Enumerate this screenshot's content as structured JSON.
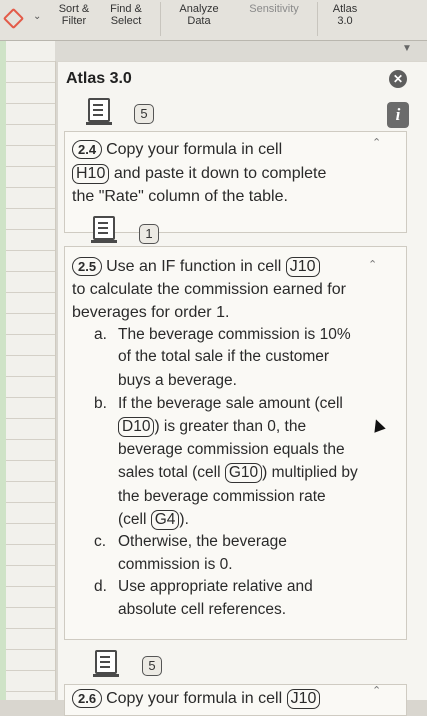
{
  "ribbon": {
    "sort": [
      "Sort &",
      "Filter"
    ],
    "find": [
      "Find &",
      "Select"
    ],
    "analyze": [
      "Analyze",
      "Data"
    ],
    "sensitivity": "Sensitivity",
    "atlas": [
      "Atlas",
      "3.0"
    ]
  },
  "pane": {
    "title": "Atlas 3.0",
    "close_icon": "close-icon",
    "info_label": "i"
  },
  "items": [
    {
      "badge": "5"
    },
    {
      "step": "2.4",
      "line1_pre": "Copy your formula in cell",
      "line2_ref": "H10",
      "line2_post": "and paste it down to complete",
      "line3": "the \"Rate\" column of the table.",
      "badge": "1"
    },
    {
      "step": "2.5",
      "line1_pre": "Use an IF function in cell",
      "line1_ref": "J10",
      "line2": "to calculate the commission earned for",
      "line3": "beverages for order 1.",
      "a_marker": "a.",
      "a1": "The beverage commission is 10%",
      "a2": "of the total sale if the customer",
      "a3": "buys a beverage.",
      "b_marker": "b.",
      "b1": "If the beverage sale amount (cell",
      "b2_ref": "D10",
      "b2_post": ") is greater than 0, the",
      "b3": "beverage commission equals the",
      "b4_pre": "sales total (cell",
      "b4_ref": "G10",
      "b4_post": ") multiplied by",
      "b5": "the beverage commission rate",
      "b6_pre": "(cell",
      "b6_ref": "G4",
      "b6_post": ").",
      "c_marker": "c.",
      "c1": "Otherwise, the beverage",
      "c2": "commission is 0.",
      "d_marker": "d.",
      "d1": "Use appropriate relative and",
      "d2": "absolute cell references."
    },
    {
      "badge": "5"
    },
    {
      "step": "2.6",
      "line1_pre": "Copy your formula in cell",
      "line1_ref": "J10"
    }
  ]
}
